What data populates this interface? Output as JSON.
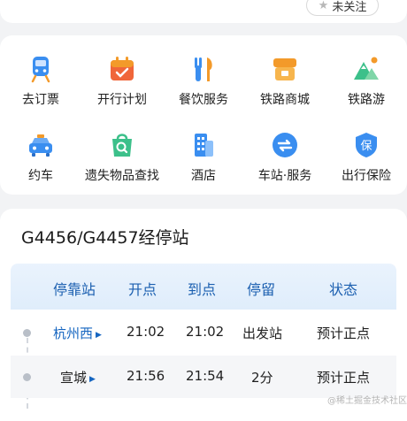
{
  "header": {
    "follow_label": "未关注"
  },
  "services": [
    {
      "label": "去订票",
      "icon": "train-ticket-icon"
    },
    {
      "label": "开行计划",
      "icon": "calendar-plan-icon"
    },
    {
      "label": "餐饮服务",
      "icon": "dining-icon"
    },
    {
      "label": "铁路商城",
      "icon": "shop-icon"
    },
    {
      "label": "铁路游",
      "icon": "travel-mountain-icon"
    },
    {
      "label": "约车",
      "icon": "taxi-icon"
    },
    {
      "label": "遗失物品查找",
      "icon": "lost-found-icon"
    },
    {
      "label": "酒店",
      "icon": "hotel-icon"
    },
    {
      "label": "车站·服务",
      "icon": "station-service-icon"
    },
    {
      "label": "出行保险",
      "icon": "insurance-icon"
    }
  ],
  "stops_section": {
    "title": "G4456/G4457经停站",
    "columns": [
      "停靠站",
      "开点",
      "到点",
      "停留",
      "状态"
    ],
    "rows": [
      {
        "station": "杭州西",
        "depart": "21:02",
        "arrive": "21:02",
        "stay": "出发站",
        "status": "预计正点"
      },
      {
        "station": "宣城",
        "depart": "21:56",
        "arrive": "21:54",
        "stay": "2分",
        "status": "预计正点"
      }
    ]
  },
  "watermark": "@稀土掘金技术社区",
  "colors": {
    "accent_blue": "#1565c0",
    "header_blue": "#1b5fb0",
    "icon_blue": "#3a8ef0",
    "icon_orange": "#f39a2a",
    "icon_green": "#3cc08a"
  }
}
